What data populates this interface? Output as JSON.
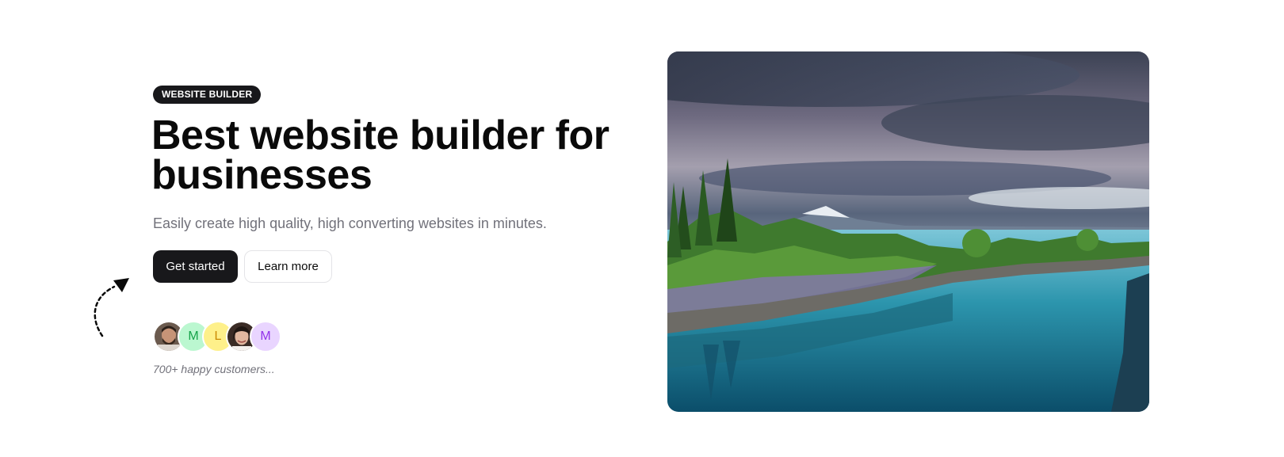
{
  "hero": {
    "badge": "WEBSITE BUILDER",
    "title": "Best website builder for businesses",
    "subtitle": "Easily create high quality, high converting websites in minutes.",
    "primary_button": "Get started",
    "secondary_button": "Learn more",
    "avatars": [
      {
        "type": "photo",
        "label": ""
      },
      {
        "type": "initial",
        "label": "M"
      },
      {
        "type": "initial",
        "label": "L"
      },
      {
        "type": "photo",
        "label": ""
      },
      {
        "type": "initial",
        "label": "M"
      }
    ],
    "customers_text": "700+ happy customers...",
    "image": "lake-landscape-photo"
  },
  "colors": {
    "primary": "#18181b",
    "muted_text": "#71717a",
    "border": "#e4e4e7"
  }
}
